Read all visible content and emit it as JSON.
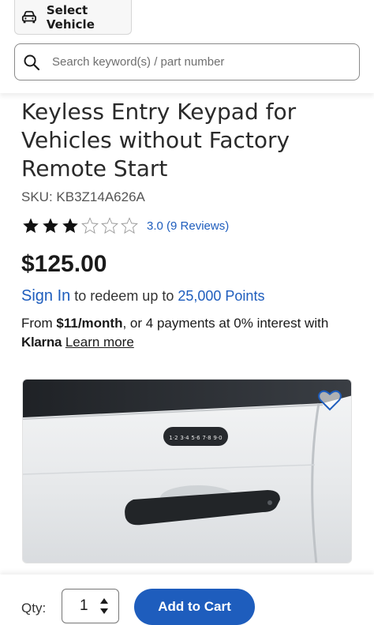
{
  "header": {
    "vehicle_button": {
      "label": "Select Vehicle",
      "icon": "car-icon"
    },
    "search": {
      "placeholder": "Search keyword(s) / part number",
      "icon": "search-icon"
    }
  },
  "product": {
    "title": "Keyless Entry Keypad for Vehicles without Factory Remote Start",
    "sku": "SKU: KB3Z14A626A",
    "rating": {
      "filled_stars": 3,
      "total_stars": 6,
      "text": "3.0 (9 Reviews)"
    },
    "price": "$125.00",
    "points": {
      "signin_label": "Sign In",
      "text_middle": " to redeem up to ",
      "points_label": "25,000 Points"
    },
    "financing": {
      "prefix": "From ",
      "amount": "$11/month",
      "suffix": ", or 4 payments at 0% interest with",
      "provider": "Klarna",
      "learn_more": "Learn more"
    },
    "image": {
      "keypad_keys": [
        "1·2",
        "3·4",
        "5·6",
        "7·8",
        "9·0"
      ],
      "favorite_icon": "heart-icon"
    }
  },
  "purchase_bar": {
    "qty_label": "Qty:",
    "qty_value": "1",
    "add_to_cart_label": "Add to Cart"
  },
  "colors": {
    "link": "#1e5dbd",
    "button": "#1e5dbd",
    "star": "#111111"
  }
}
